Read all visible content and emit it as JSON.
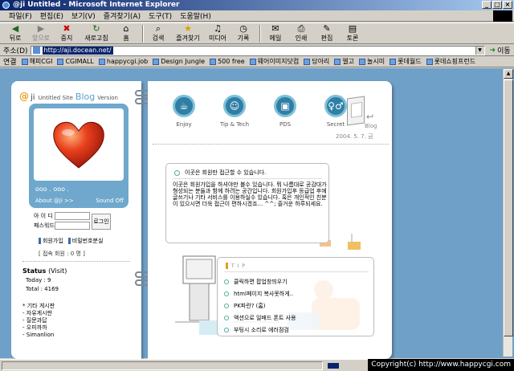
{
  "window": {
    "title": "@ji Untitled - Microsoft Internet Explorer",
    "min": "_",
    "max": "□",
    "close": "×"
  },
  "menu": [
    "파일(F)",
    "편집(E)",
    "보기(V)",
    "즐겨찾기(A)",
    "도구(T)",
    "도움말(H)"
  ],
  "toolbar": {
    "back": "뒤로",
    "forward": "앞으로",
    "stop": "중지",
    "refresh": "새로고침",
    "home": "홈",
    "search": "검색",
    "favorites": "즐겨찾기",
    "media": "미디어",
    "history": "기록",
    "mail": "메일",
    "print": "인쇄",
    "edit": "편집",
    "discuss": "토론"
  },
  "address": {
    "label": "주소(D)",
    "url": "http://aji.docean.net/",
    "go": "이동"
  },
  "links": {
    "label": "연결",
    "items": [
      "해피CGI",
      "CGIMALL",
      "happycgi.job",
      "Design Jungle",
      "500 free",
      "웨어이미지닷컴",
      "담아리",
      "엘고",
      "놀시미",
      "롯데월드",
      "롯데쇼핑프런드"
    ]
  },
  "sidebar": {
    "at": "@",
    "ji": "ji",
    "untitled": "Untitled Site",
    "blog": "Blog",
    "version": "Version",
    "dots": "ooo . ooo .",
    "about": "About @ji >>",
    "sound": "Sound Off",
    "id_label": "아 이 디",
    "pw_label": "패스워드",
    "login": "로그인",
    "join": "회원가입",
    "find_pw": "비밀번호분실",
    "online": "[ 접속 회원 : 0 명 ]",
    "status_title": "Status",
    "status_visit": "(Visit)",
    "today": "Today :  9",
    "total": "Total :  4169",
    "misc": [
      "* 기타 게시판",
      "- 자유게시판",
      "- 질문과답",
      "- 오미까까",
      "- Simanlion"
    ]
  },
  "nav": [
    {
      "label": "Enjoy",
      "icon": "cup-icon"
    },
    {
      "label": "Tip & Tech",
      "icon": "people-icon"
    },
    {
      "label": "PDS",
      "icon": "disk-icon"
    },
    {
      "label": "Secret",
      "icon": "couple-icon"
    }
  ],
  "blog_label": "Blog",
  "date": "2004. 5. 7. 금",
  "notice": {
    "title": "이곳은 회원만 접근할 수 있습니다.",
    "body": "이곳은 회원가입을 하셔야만 볼수 있습니다. 뭐 나름대로 공감대가 형성되는 분들과 함께 하려는 공간입니다. 회원가입후 등급업 후에 글쓰기나 기타 서비스를 이용하실수 있습니다. 혹은 개인적인 친분이 있으시면 더욱 접근이 편하시겠죠... ^^; 즐거운 하루되세요."
  },
  "tip": {
    "title": "T I P",
    "items": [
      "클릭하면 팝업창띄우기",
      "html페이지 복사못하게..",
      "PK파란? (홈)",
      "액션으로 일배드 폰트 사용",
      "부팅시 소리로 에러점검"
    ]
  },
  "copyright": "Copyright(c) http://www.happycgi.com"
}
